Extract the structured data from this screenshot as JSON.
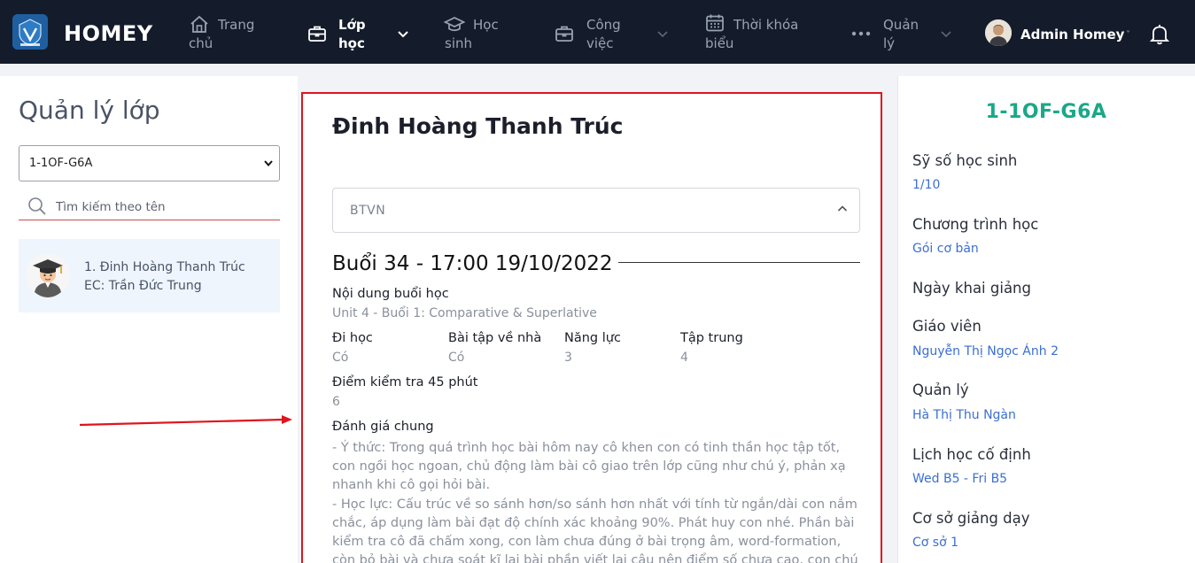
{
  "navbar": {
    "brand": "HOMEY",
    "items": [
      {
        "label_l1": "Trang",
        "label_l2": "chủ",
        "icon": "home-icon"
      },
      {
        "label_l1": "Lớp",
        "label_l2": "học",
        "icon": "briefcase-icon",
        "active": true
      },
      {
        "label_l1": "Học",
        "label_l2": "sinh",
        "icon": "graduation-cap-icon"
      },
      {
        "label_l1": "Công",
        "label_l2": "việc",
        "icon": "briefcase-icon"
      },
      {
        "label_l1": "Thời khóa",
        "label_l2": "biểu",
        "icon": "calendar-icon"
      },
      {
        "label_l1": "Quản",
        "label_l2": "lý",
        "icon": "more-icon"
      }
    ],
    "user_name": "Admin Homey",
    "user_caret": "˅"
  },
  "left": {
    "title": "Quản lý lớp",
    "selected_class": "1-1OF-G6A",
    "search_placeholder": "Tìm kiếm theo tên",
    "students": [
      {
        "name": "1. Đinh Hoàng Thanh Trúc",
        "ec": "EC: Trần Đức Trung"
      }
    ]
  },
  "center": {
    "student_name": "Đinh Hoàng Thanh Trúc",
    "accordion_label": "BTVN",
    "session_title": "Buổi 34 - 17:00 19/10/2022",
    "content_label": "Nội dung buổi học",
    "content_value": "Unit 4 - Buổi 1: Comparative & Superlative",
    "attend_label": "Đi học",
    "attend_value": "Có",
    "homework_label": "Bài tập về nhà",
    "homework_value": "Có",
    "ability_label": "Năng lực",
    "ability_value": "3",
    "focus_label": "Tập trung",
    "focus_value": "4",
    "test_label": "Điểm kiểm tra 45 phút",
    "test_value": "6",
    "eval_label": "Đánh giá chung",
    "eval_p1": "- Ý thức: Trong quá trình học bài hôm nay cô khen con có tinh thần học tập tốt, con ngồi học ngoan, chủ động làm bài cô giao trên lớp cũng như chú ý, phản xạ nhanh khi cô gọi hỏi bài.",
    "eval_p2": "- Học lực: Cấu trúc về so sánh hơn/so sánh hơn nhất với tính từ ngắn/dài con nắm chắc, áp dụng làm bài đạt độ chính xác khoảng 90%. Phát huy con nhé. Phần bài kiểm tra cô đã chấm xong, con làm chưa đúng ở bài trọng âm, word-formation, còn bỏ bài và chưa soát kĩ lại bài phần viết lại câu nên điểm số chưa cao, con chú ý"
  },
  "right": {
    "class_code": "1-1OF-G6A",
    "info": [
      {
        "label": "Sỹ số học sinh",
        "value": "1/10"
      },
      {
        "label": "Chương trình học",
        "value": "Gói cơ bản"
      },
      {
        "label": "Ngày khai giảng",
        "value": ""
      },
      {
        "label": "Giáo viên",
        "value": "Nguyễn Thị Ngọc Ánh 2"
      },
      {
        "label": "Quản lý",
        "value": "Hà Thị Thu Ngàn"
      },
      {
        "label": "Lịch học cố định",
        "value": "Wed B5 - Fri B5"
      },
      {
        "label": "Cơ sở giảng dạy",
        "value": "Cơ sở 1"
      }
    ]
  },
  "colors": {
    "nav_bg": "#141c2b",
    "accent_green": "#1aa889",
    "link_blue": "#3b6fd1",
    "highlight_red": "#e0141e"
  }
}
